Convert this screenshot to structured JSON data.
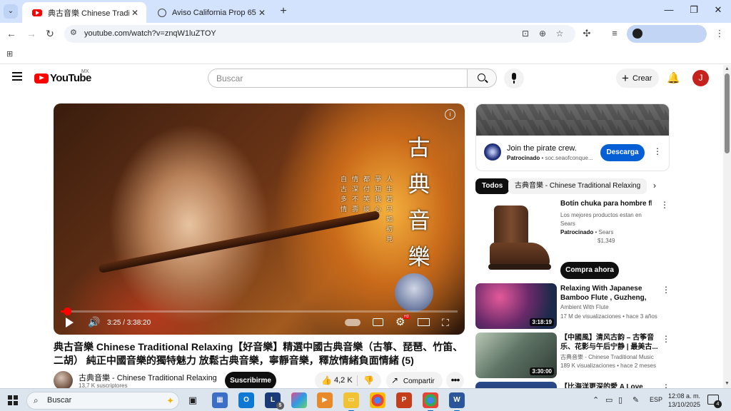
{
  "browser": {
    "tabs": [
      {
        "title": "典古音樂 Chinese Traditional R",
        "active": true
      },
      {
        "title": "Aviso California Prop 65",
        "active": false
      }
    ],
    "url": "youtube.com/watch?v=znqW1luZTOY"
  },
  "youtube": {
    "logo_text": "YouTube",
    "region": "MX",
    "search_placeholder": "Buscar",
    "create_label": "Crear",
    "avatar_letter": "J"
  },
  "player": {
    "calligraphy": "古典音樂",
    "poem_columns": [
      "人生若只如初見",
      "爭知我心",
      "都付笑談",
      "情深不壽",
      "自古多情"
    ],
    "time": "3:25 / 3:38:20",
    "progress_fraction": 0.016
  },
  "video": {
    "title": "典古音樂 Chinese Traditional Relaxing【好音樂】精選中國古典音樂（古箏、琵琶、竹笛、二胡） 純正中國音樂的獨特魅力 放鬆古典音樂，寧靜音樂，釋放情緒負面情緒 (5)",
    "channel": "古典音樂 - Chinese Traditional Relaxing",
    "subscribers": "13,7 K suscriptores",
    "subscribe_label": "Suscribirme",
    "likes": "4,2 K",
    "share_label": "Compartir"
  },
  "ad": {
    "title": "Join the pirate crew.",
    "sponsor_label": "Patrocinado",
    "sponsor_domain": "soc.seaofconque...",
    "cta": "Descarga"
  },
  "chips": [
    "Todos",
    "古典音樂 - Chinese Traditional Relaxing"
  ],
  "shop": {
    "title": "Botín chuka para hombre flexi",
    "desc": "Los mejores productos estan en Sears",
    "sponsor_label": "Patrocinado",
    "seller": "Sears",
    "price": "$1,349",
    "cta": "Compra ahora"
  },
  "recommendations": [
    {
      "title": "Relaxing With Japanese Bamboo Flute , Guzheng, Erhu ...",
      "channel": "Ambient With Flute",
      "meta": "17 M de visualizaciones • hace 3 años",
      "duration": "3:18:19"
    },
    {
      "title": "【中國風】清风古韵 – 古筝音乐、花影与午后宁静 | 最美古...",
      "channel": "古典音樂 - Chinese Traditional Music",
      "meta": "189 K visualizaciones • hace 2 meses",
      "duration": "3:30:00"
    },
    {
      "title": "【比海洋更深的愛 A Love",
      "channel": "",
      "meta": "",
      "duration": ""
    }
  ],
  "taskbar": {
    "search_placeholder": "Buscar",
    "lang": "ESP",
    "time": "12:08 a. m.",
    "date": "13/10/2025",
    "notification_count": "4",
    "badge_l": "5"
  },
  "colors": {
    "yt_red": "#ff0000",
    "subscribe_black": "#0f0f0f",
    "cta_blue": "#065fd4",
    "chrome_tabstrip": "#d3e3fd"
  }
}
